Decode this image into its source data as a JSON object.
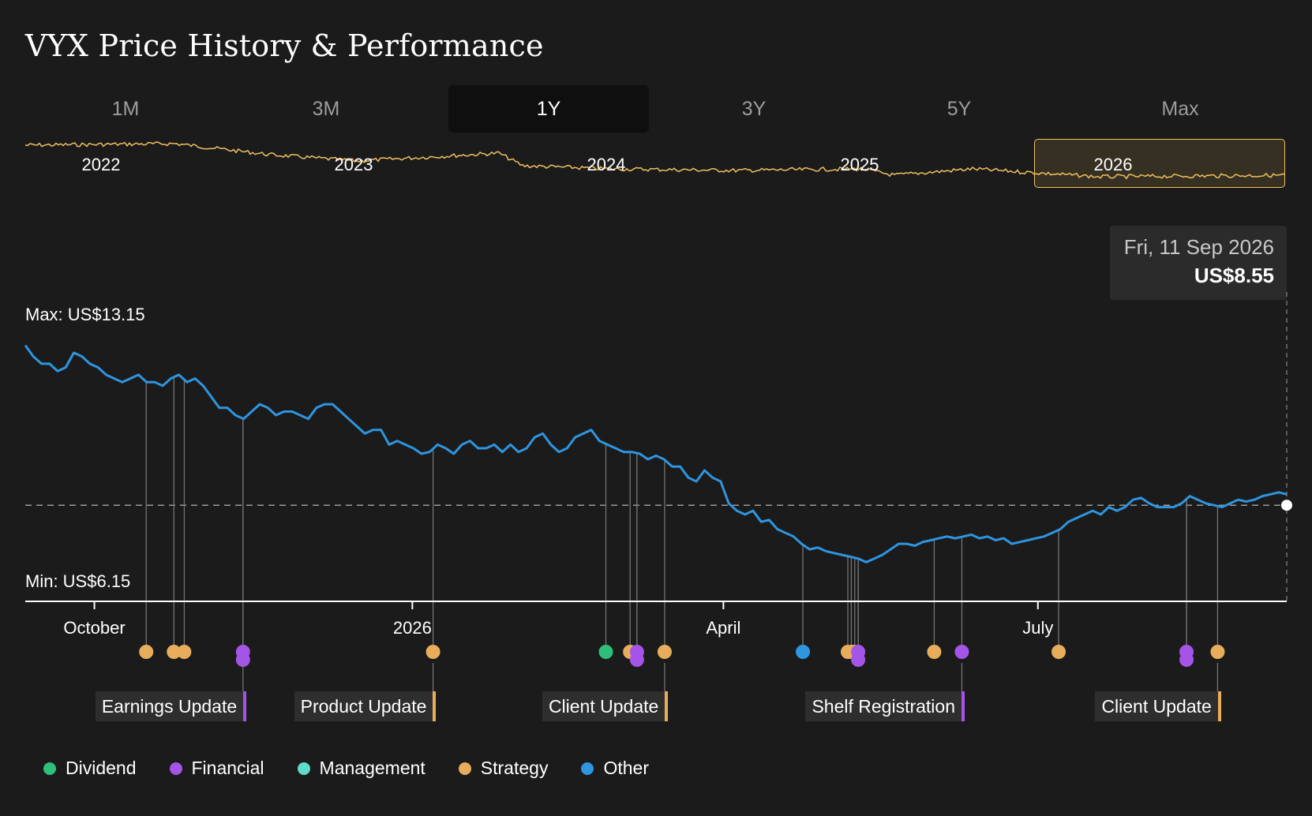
{
  "title": "VYX Price History & Performance",
  "tabs": [
    {
      "label": "1M",
      "active": false
    },
    {
      "label": "3M",
      "active": false
    },
    {
      "label": "1Y",
      "active": true
    },
    {
      "label": "3Y",
      "active": false
    },
    {
      "label": "5Y",
      "active": false
    },
    {
      "label": "Max",
      "active": false
    }
  ],
  "navigator": {
    "years": [
      "2022",
      "2023",
      "2024",
      "2025",
      "2026"
    ],
    "selected": "2026",
    "color": "#f0c060"
  },
  "tooltip": {
    "date": "Fri, 11 Sep 2026",
    "price": "US$8.55"
  },
  "colors": {
    "price_line": "#2e95e0",
    "background": "#1b1b1b",
    "Dividend": "#2fbf7a",
    "Financial": "#a455e8",
    "Management": "#5fdcc8",
    "Strategy": "#e8ad5c",
    "Other": "#2e95e0"
  },
  "chart_data": {
    "type": "line",
    "series": [
      {
        "values": [
          12.9,
          12.6,
          12.4,
          12.4,
          12.2,
          12.3,
          12.7,
          12.6,
          12.4,
          12.3,
          12.1,
          12.0,
          11.9,
          12.0,
          12.1,
          11.9,
          11.9,
          11.8,
          12.0,
          12.1,
          11.9,
          12.0,
          11.8,
          11.5,
          11.2,
          11.2,
          11.0,
          10.9,
          11.1,
          11.3,
          11.2,
          11.0,
          11.1,
          11.1,
          11.0,
          10.9,
          11.2,
          11.3,
          11.3,
          11.1,
          10.9,
          10.7,
          10.5,
          10.6,
          10.6,
          10.2,
          10.3,
          10.2,
          10.1,
          9.95,
          10.0,
          10.2,
          10.1,
          9.95,
          10.2,
          10.3,
          10.1,
          10.1,
          10.2,
          10.0,
          10.2,
          10.0,
          10.1,
          10.4,
          10.5,
          10.2,
          10.0,
          10.1,
          10.4,
          10.5,
          10.6,
          10.3,
          10.2,
          10.1,
          10.0,
          10.0,
          9.95,
          9.8,
          9.9,
          9.8,
          9.6,
          9.6,
          9.3,
          9.2,
          9.5,
          9.3,
          9.2,
          8.6,
          8.4,
          8.3,
          8.4,
          8.1,
          8.15,
          7.9,
          7.8,
          7.7,
          7.5,
          7.35,
          7.4,
          7.3,
          7.25,
          7.2,
          7.15,
          7.1,
          7.0,
          7.1,
          7.2,
          7.35,
          7.5,
          7.5,
          7.45,
          7.55,
          7.6,
          7.65,
          7.7,
          7.65,
          7.7,
          7.75,
          7.65,
          7.7,
          7.6,
          7.65,
          7.5,
          7.55,
          7.6,
          7.65,
          7.7,
          7.8,
          7.9,
          8.1,
          8.2,
          8.3,
          8.4,
          8.3,
          8.5,
          8.4,
          8.5,
          8.7,
          8.75,
          8.6,
          8.5,
          8.5,
          8.5,
          8.6,
          8.8,
          8.7,
          8.6,
          8.55,
          8.5,
          8.6,
          8.7,
          8.65,
          8.7,
          8.8,
          8.85,
          8.9,
          8.85
        ],
        "x_start": "2025-09-11",
        "x_end": "2026-09-11"
      }
    ],
    "title": "VYX Price History & Performance",
    "xlabel": "",
    "ylabel": "",
    "x_ticks": [
      "October",
      "2026",
      "April",
      "July"
    ],
    "ylim": [
      6.15,
      13.15
    ],
    "max_label": "Max: US$13.15",
    "min_label": "Min: US$6.15",
    "reference_value": 8.55,
    "events": [
      {
        "date": "2025-10-16",
        "category": "Strategy"
      },
      {
        "date": "2025-10-24",
        "category": "Strategy"
      },
      {
        "date": "2025-10-27",
        "category": "Strategy"
      },
      {
        "date": "2025-11-13",
        "category": "Financial"
      },
      {
        "date": "2025-11-13",
        "category": "Financial"
      },
      {
        "date": "2026-01-07",
        "category": "Strategy"
      },
      {
        "date": "2026-02-26",
        "category": "Dividend"
      },
      {
        "date": "2026-03-05",
        "category": "Strategy"
      },
      {
        "date": "2026-03-07",
        "category": "Financial"
      },
      {
        "date": "2026-03-07",
        "category": "Financial"
      },
      {
        "date": "2026-03-15",
        "category": "Strategy"
      },
      {
        "date": "2026-04-24",
        "category": "Other"
      },
      {
        "date": "2026-05-07",
        "category": "Strategy"
      },
      {
        "date": "2026-05-08",
        "category": "Strategy"
      },
      {
        "date": "2026-05-09",
        "category": "Strategy"
      },
      {
        "date": "2026-05-10",
        "category": "Financial"
      },
      {
        "date": "2026-05-10",
        "category": "Financial"
      },
      {
        "date": "2026-06-01",
        "category": "Strategy"
      },
      {
        "date": "2026-06-09",
        "category": "Financial"
      },
      {
        "date": "2026-07-07",
        "category": "Strategy"
      },
      {
        "date": "2026-08-13",
        "category": "Financial"
      },
      {
        "date": "2026-08-13",
        "category": "Financial"
      },
      {
        "date": "2026-08-22",
        "category": "Strategy"
      }
    ],
    "event_labels": [
      {
        "text": "Earnings Update",
        "category": "Financial",
        "date": "2025-11-13"
      },
      {
        "text": "Product Update",
        "category": "Strategy",
        "date": "2026-01-07"
      },
      {
        "text": "Client Update",
        "category": "Strategy",
        "date": "2026-03-15"
      },
      {
        "text": "Shelf Registration",
        "category": "Financial",
        "date": "2026-06-09"
      },
      {
        "text": "Client Update",
        "category": "Strategy",
        "date": "2026-08-22"
      }
    ],
    "legend": [
      "Dividend",
      "Financial",
      "Management",
      "Strategy",
      "Other"
    ]
  }
}
